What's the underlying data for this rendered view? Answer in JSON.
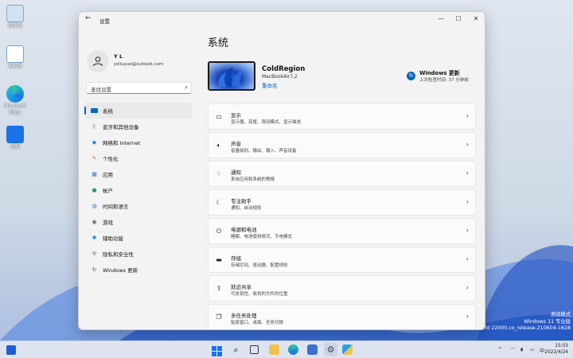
{
  "desktop": {
    "icons": [
      {
        "label": "回收站"
      },
      {
        "label": "无标题"
      },
      {
        "label": "Microsoft Edge"
      },
      {
        "label": "远程"
      }
    ],
    "watermark": {
      "line1": "测试模式",
      "line2": "Windows 11 专业版",
      "line3": "Build 22000.co_release.210604-1628"
    }
  },
  "window": {
    "title": "设置",
    "back_icon": "back-arrow-icon",
    "controls": [
      "minimize",
      "maximize",
      "close"
    ]
  },
  "user": {
    "name": "Y L",
    "email": "ysliuyue@outlook.com"
  },
  "search": {
    "placeholder": "查找设置"
  },
  "nav": [
    {
      "label": "系统",
      "icon": "monitor-icon",
      "active": true
    },
    {
      "label": "蓝牙和其他设备",
      "icon": "bluetooth-icon",
      "active": false
    },
    {
      "label": "网络和 Internet",
      "icon": "wifi-icon",
      "active": false
    },
    {
      "label": "个性化",
      "icon": "brush-icon",
      "active": false
    },
    {
      "label": "应用",
      "icon": "apps-icon",
      "active": false
    },
    {
      "label": "帐户",
      "icon": "person-icon",
      "active": false
    },
    {
      "label": "时间和语言",
      "icon": "globe-clock-icon",
      "active": false
    },
    {
      "label": "游戏",
      "icon": "gamepad-icon",
      "active": false
    },
    {
      "label": "辅助功能",
      "icon": "accessibility-icon",
      "active": false
    },
    {
      "label": "隐私和安全性",
      "icon": "shield-icon",
      "active": false
    },
    {
      "label": "Windows 更新",
      "icon": "update-icon",
      "active": false
    }
  ],
  "main": {
    "heading": "系统",
    "device": {
      "name": "ColdRegion",
      "model": "MacBookAir7,2",
      "rename": "重命名"
    },
    "update": {
      "title": "Windows 更新",
      "subtitle": "上次检查时间: 37 分钟前"
    },
    "cards": [
      {
        "title": "显示",
        "subtitle": "显示器、亮度、夜间模式、显示描述",
        "icon": "display-icon"
      },
      {
        "title": "声音",
        "subtitle": "音量级别、输出、输入、声音设备",
        "icon": "speaker-icon"
      },
      {
        "title": "通知",
        "subtitle": "来自应用和系统的警报",
        "icon": "bell-icon"
      },
      {
        "title": "专注助手",
        "subtitle": "通知、自动规则",
        "icon": "moon-icon"
      },
      {
        "title": "电源和电池",
        "subtitle": "睡眠、电池使用情况、节电模式",
        "icon": "power-icon"
      },
      {
        "title": "存储",
        "subtitle": "存储空间、驱动器、配置规则",
        "icon": "storage-icon"
      },
      {
        "title": "就近共享",
        "subtitle": "可发现性、收到的文件的位置",
        "icon": "share-icon"
      },
      {
        "title": "多任务处理",
        "subtitle": "贴靠窗口、桌面、任务切换",
        "icon": "multitask-icon"
      }
    ]
  },
  "taskbar": {
    "apps": [
      "start-icon",
      "search-icon",
      "task-view-icon",
      "file-explorer-icon",
      "edge-icon",
      "store-icon",
      "settings-icon",
      "security-icon"
    ],
    "time": "15:03",
    "date": "2022/4/24",
    "ime": "中"
  },
  "colors": {
    "accent": "#0067c0",
    "window_bg": "#f3f3f3",
    "card_bg": "#fbfbfb"
  }
}
